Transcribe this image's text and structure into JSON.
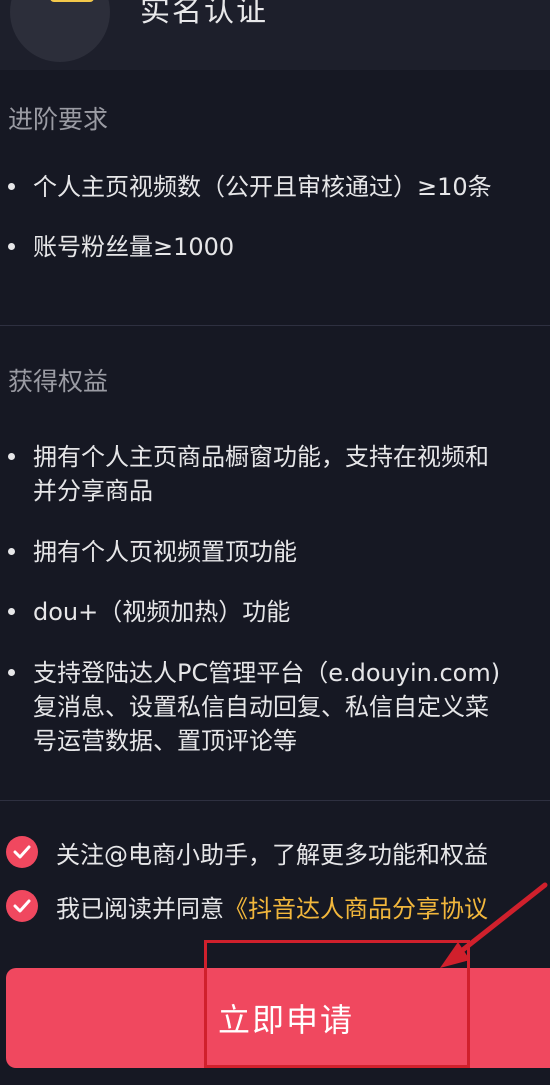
{
  "header": {
    "title": "实名认证"
  },
  "requirements": {
    "title": "进阶要求",
    "items": [
      {
        "lines": [
          "个人主页视频数（公开且审核通过）≥10条"
        ]
      },
      {
        "lines": [
          "账号粉丝量≥1000"
        ]
      }
    ]
  },
  "benefits": {
    "title": "获得权益",
    "items": [
      {
        "lines": [
          "拥有个人主页商品橱窗功能，支持在视频和",
          "并分享商品"
        ]
      },
      {
        "lines": [
          "拥有个人页视频置顶功能"
        ]
      },
      {
        "lines": [
          "dou+（视频加热）功能"
        ]
      },
      {
        "lines": [
          "支持登陆达人PC管理平台（e.douyin.com)",
          "复消息、设置私信自动回复、私信自定义菜",
          "号运营数据、置顶评论等"
        ]
      }
    ]
  },
  "checks": {
    "follow": "关注@电商小助手，了解更多功能和权益",
    "agree_prefix": "我已阅读并同意",
    "agree_link": "《抖音达人商品分享协议"
  },
  "apply_button": "立即申请",
  "colors": {
    "accent": "#f0485f",
    "link": "#f2b73c",
    "background": "#161823"
  }
}
